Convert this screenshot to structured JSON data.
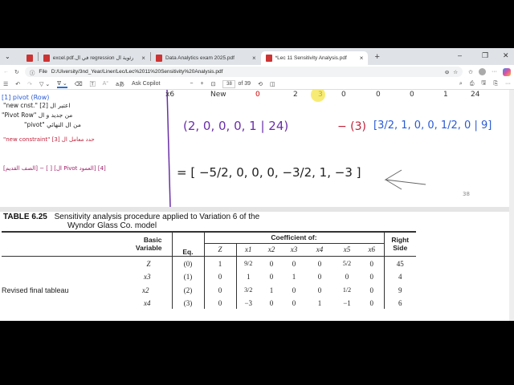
{
  "browser": {
    "tabs": [
      {
        "label": "excel.pdf.في ال regression رئوية ال",
        "active": false
      },
      {
        "label": "Data Analytics exam 2025.pdf",
        "active": false
      },
      {
        "label": "*Lec 11 Sensitivity Analysis.pdf",
        "active": true
      }
    ],
    "new_tab": "+",
    "window": {
      "min": "–",
      "restore": "❐",
      "close": "✕"
    },
    "url_prefix": "File",
    "url": "D:/Uiversity/3nd_Year/Liner/Lec/Lec%2011%20Sensitivity%20Analysis.pdf",
    "toolbar": {
      "ask_copilot": "Ask Copilot",
      "zoom_out": "−",
      "zoom_in": "+",
      "page": "38",
      "of_pages": "of 39"
    }
  },
  "slide": {
    "top_row": [
      "x6",
      "New",
      "0",
      "2",
      "3",
      "0",
      "0",
      "0",
      "1",
      "24"
    ],
    "notes": [
      "\"new cnst.\" اعتبر ال [2]",
      "\"Pivot Row\" من جديد و ال",
      "\"pivot\" من ال النهائي",
      "\"new constraint\" حدد معامل ال [3]",
      "[الصف القديم] − [ ] [ال Pivot العمود] [4]"
    ],
    "eq1_left": "(2, 0, 0, 0, 1 | 24)",
    "eq1_mult": "− (3)",
    "eq1_right": "[3/2, 1, 0, 0, 1/2, 0 | 9]",
    "eq2": "= [ −5/2, 0, 0, 0, −3/2, 1, −3 ]",
    "page_number": "38"
  },
  "table": {
    "caption_label": "TABLE 6.25",
    "caption": "Sensitivity analysis procedure applied to Variation 6 of the",
    "caption2": "Wyndor Glass Co. model",
    "coef_header": "Coefficient of:",
    "h_basic": "Basic",
    "h_variable": "Variable",
    "h_eq": "Eq.",
    "h_right": "Right",
    "h_side": "Side",
    "cols": [
      "Z",
      "x1",
      "x2",
      "x3",
      "x4",
      "x5",
      "x6"
    ],
    "row_label": "Revised final tableau",
    "rows": [
      {
        "var": "Z",
        "eq": "(0)",
        "z": "1",
        "x1": "9/2",
        "x2": "0",
        "x3": "0",
        "x4": "0",
        "x5": "5/2",
        "x6": "0",
        "rhs": "45"
      },
      {
        "var": "x3",
        "eq": "(1)",
        "z": "0",
        "x1": "1",
        "x2": "0",
        "x3": "1",
        "x4": "0",
        "x5": "0",
        "x6": "0",
        "rhs": "4"
      },
      {
        "var": "x2",
        "eq": "(2)",
        "z": "0",
        "x1": "3/2",
        "x2": "1",
        "x3": "0",
        "x4": "0",
        "x5": "1/2",
        "x6": "0",
        "rhs": "9"
      },
      {
        "var": "x4",
        "eq": "(3)",
        "z": "0",
        "x1": "−3",
        "x2": "0",
        "x3": "0",
        "x4": "1",
        "x5": "−1",
        "x6": "0",
        "rhs": "6"
      }
    ]
  }
}
